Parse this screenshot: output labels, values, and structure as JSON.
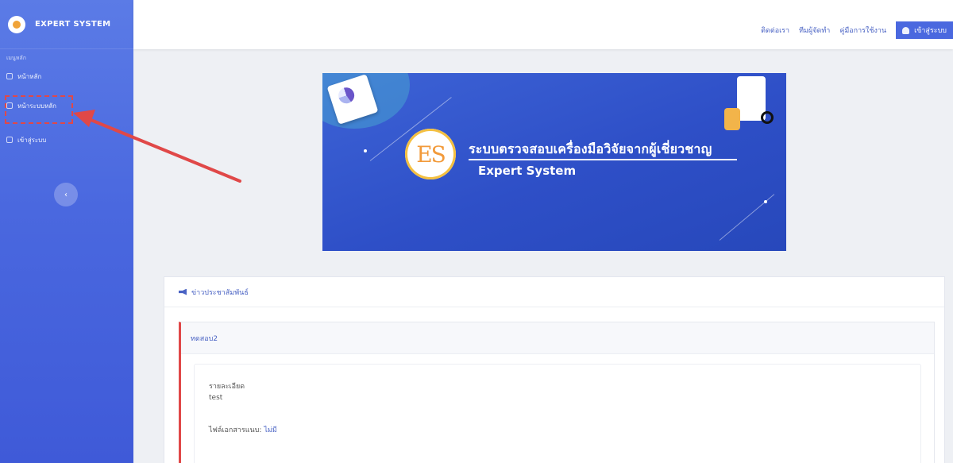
{
  "sidebar": {
    "brand": "EXPERT SYSTEM",
    "heading": "เมนูหลัก",
    "items": [
      {
        "label": "หน้าหลัก",
        "icon": "home-icon"
      },
      {
        "label": "หน้าระบบหลัก",
        "icon": "grid-icon"
      },
      {
        "label": "เข้าสู่ระบบ",
        "icon": "login-icon"
      }
    ],
    "collapse_icon": "chevron-left-icon"
  },
  "topbar": {
    "links": [
      "ติดต่อเรา",
      "ทีมผู้จัดทำ",
      "คู่มือการใช้งาน"
    ],
    "login_label": "เข้าสู่ระบบ"
  },
  "banner": {
    "logo_text": "ES",
    "title": "ระบบตรวจสอบเครื่องมือวิจัยจากผู้เชี่ยวชาญ",
    "subtitle": "Expert System"
  },
  "news": {
    "heading": "ข่าวประชาสัมพันธ์",
    "card": {
      "title": "ทดสอบ2",
      "detail_label": "รายละเอียด",
      "detail_value": "test",
      "attachment_label": "ไฟล์เอกสารแนบ:",
      "attachment_link": "ไม่มี"
    }
  },
  "colors": {
    "sidebar": "#4a68df",
    "accent": "#4a63c4",
    "highlight": "#e04848"
  }
}
